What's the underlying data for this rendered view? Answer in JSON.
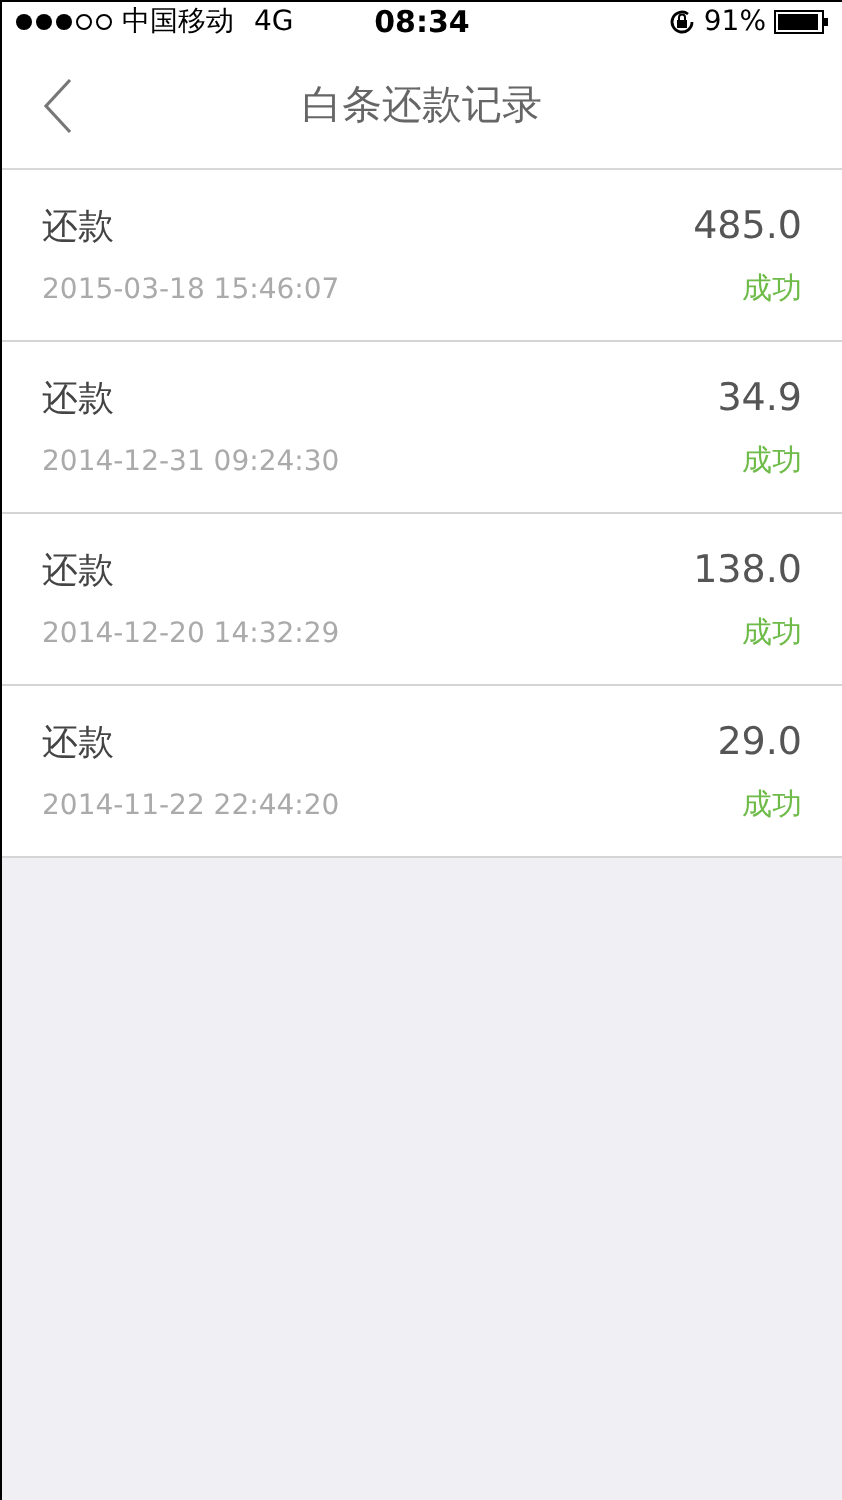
{
  "status_bar": {
    "carrier": "中国移动",
    "network": "4G",
    "time": "08:34",
    "battery": "91%"
  },
  "nav": {
    "title": "白条还款记录"
  },
  "records": [
    {
      "type": "还款",
      "amount": "485.0",
      "time": "2015-03-18 15:46:07",
      "status": "成功"
    },
    {
      "type": "还款",
      "amount": "34.9",
      "time": "2014-12-31 09:24:30",
      "status": "成功"
    },
    {
      "type": "还款",
      "amount": "138.0",
      "time": "2014-12-20 14:32:29",
      "status": "成功"
    },
    {
      "type": "还款",
      "amount": "29.0",
      "time": "2014-11-22 22:44:20",
      "status": "成功"
    }
  ]
}
